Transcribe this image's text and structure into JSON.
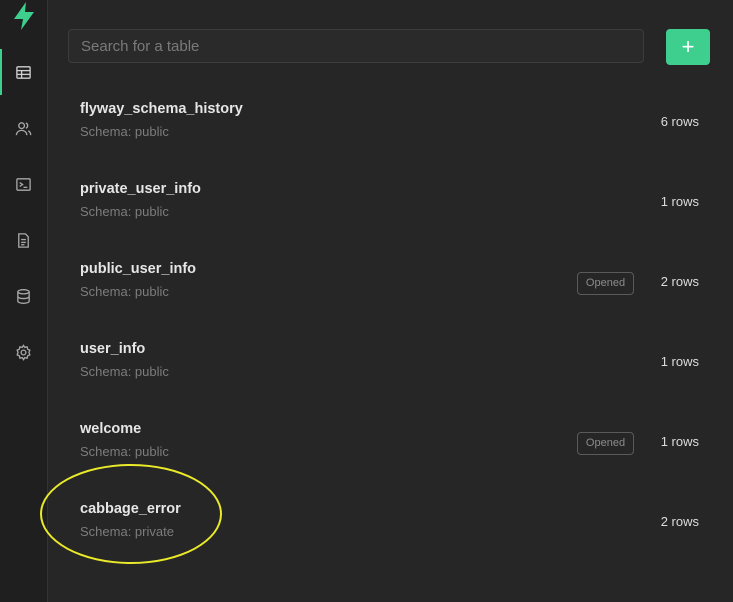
{
  "search": {
    "placeholder": "Search for a table"
  },
  "add_button": {
    "label": "+"
  },
  "sidebar": {
    "items": [
      {
        "name": "table-editor",
        "icon": "table-icon",
        "active": true
      },
      {
        "name": "users",
        "icon": "users-icon",
        "active": false
      },
      {
        "name": "sql",
        "icon": "terminal-icon",
        "active": false
      },
      {
        "name": "docs",
        "icon": "document-icon",
        "active": false
      },
      {
        "name": "database",
        "icon": "database-icon",
        "active": false
      },
      {
        "name": "settings",
        "icon": "gear-icon",
        "active": false
      }
    ]
  },
  "tables": [
    {
      "name": "flyway_schema_history",
      "schema": "Schema: public",
      "rows": "6 rows",
      "badge": ""
    },
    {
      "name": "private_user_info",
      "schema": "Schema: public",
      "rows": "1 rows",
      "badge": ""
    },
    {
      "name": "public_user_info",
      "schema": "Schema: public",
      "rows": "2 rows",
      "badge": "Opened"
    },
    {
      "name": "user_info",
      "schema": "Schema: public",
      "rows": "1 rows",
      "badge": ""
    },
    {
      "name": "welcome",
      "schema": "Schema: public",
      "rows": "1 rows",
      "badge": "Opened"
    },
    {
      "name": "cabbage_error",
      "schema": "Schema: private",
      "rows": "2 rows",
      "badge": ""
    }
  ],
  "colors": {
    "accent": "#3ecf8e",
    "background": "#262626",
    "highlight": "#eaea2a"
  }
}
